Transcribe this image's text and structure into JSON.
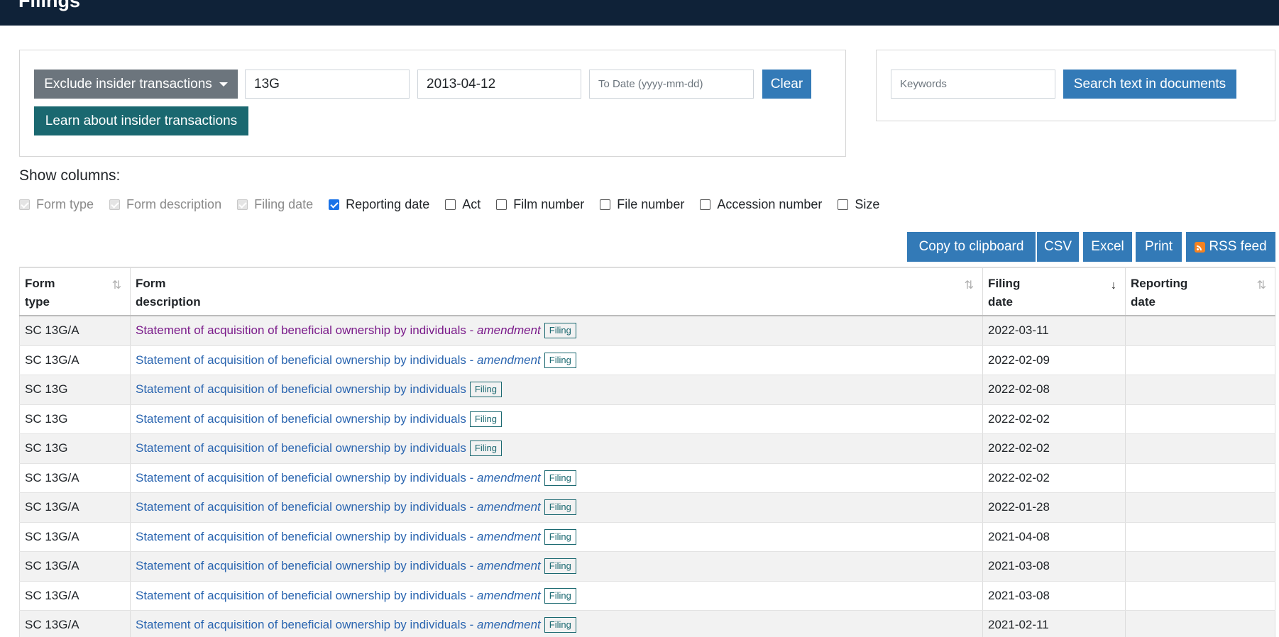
{
  "header": {
    "title": "Filings"
  },
  "filters": {
    "insider_dropdown_label": "Exclude insider transactions",
    "form_type_value": "13G",
    "from_date_value": "2013-04-12",
    "to_date_placeholder": "To Date (yyyy-mm-dd)",
    "clear_label": "Clear",
    "learn_label": "Learn about insider transactions"
  },
  "search": {
    "keywords_placeholder": "Keywords",
    "search_label": "Search text in documents"
  },
  "columns": {
    "heading": "Show columns:",
    "options": [
      {
        "label": "Form type",
        "checked": true,
        "disabled": true
      },
      {
        "label": "Form description",
        "checked": true,
        "disabled": true
      },
      {
        "label": "Filing date",
        "checked": true,
        "disabled": true
      },
      {
        "label": "Reporting date",
        "checked": true,
        "disabled": false
      },
      {
        "label": "Act",
        "checked": false,
        "disabled": false
      },
      {
        "label": "Film number",
        "checked": false,
        "disabled": false
      },
      {
        "label": "File number",
        "checked": false,
        "disabled": false
      },
      {
        "label": "Accession number",
        "checked": false,
        "disabled": false
      },
      {
        "label": "Size",
        "checked": false,
        "disabled": false
      }
    ]
  },
  "export": {
    "clipboard_label": "Copy to clipboard",
    "csv_label": "CSV",
    "excel_label": "Excel",
    "print_label": "Print",
    "rss_label": "RSS feed"
  },
  "table": {
    "headers": {
      "form_type": [
        "Form",
        "type"
      ],
      "form_description": [
        "Form",
        "description"
      ],
      "filing_date": [
        "Filing",
        "date"
      ],
      "reporting_date": [
        "Reporting",
        "date"
      ]
    },
    "sort_icons": {
      "inactive": "⇅",
      "active": "↓"
    },
    "badge_label": "Filing",
    "description_base": "Statement of acquisition of beneficial ownership by individuals",
    "amendment_suffix": "amendment",
    "rows": [
      {
        "form_type": "SC 13G/A",
        "amendment": true,
        "visited": true,
        "filing_date": "2022-03-11",
        "reporting_date": ""
      },
      {
        "form_type": "SC 13G/A",
        "amendment": true,
        "visited": false,
        "filing_date": "2022-02-09",
        "reporting_date": ""
      },
      {
        "form_type": "SC 13G",
        "amendment": false,
        "visited": false,
        "filing_date": "2022-02-08",
        "reporting_date": ""
      },
      {
        "form_type": "SC 13G",
        "amendment": false,
        "visited": false,
        "filing_date": "2022-02-02",
        "reporting_date": ""
      },
      {
        "form_type": "SC 13G",
        "amendment": false,
        "visited": false,
        "filing_date": "2022-02-02",
        "reporting_date": ""
      },
      {
        "form_type": "SC 13G/A",
        "amendment": true,
        "visited": false,
        "filing_date": "2022-02-02",
        "reporting_date": ""
      },
      {
        "form_type": "SC 13G/A",
        "amendment": true,
        "visited": false,
        "filing_date": "2022-01-28",
        "reporting_date": ""
      },
      {
        "form_type": "SC 13G/A",
        "amendment": true,
        "visited": false,
        "filing_date": "2021-04-08",
        "reporting_date": ""
      },
      {
        "form_type": "SC 13G/A",
        "amendment": true,
        "visited": false,
        "filing_date": "2021-03-08",
        "reporting_date": ""
      },
      {
        "form_type": "SC 13G/A",
        "amendment": true,
        "visited": false,
        "filing_date": "2021-03-08",
        "reporting_date": ""
      },
      {
        "form_type": "SC 13G/A",
        "amendment": true,
        "visited": false,
        "filing_date": "2021-02-11",
        "reporting_date": ""
      }
    ]
  }
}
